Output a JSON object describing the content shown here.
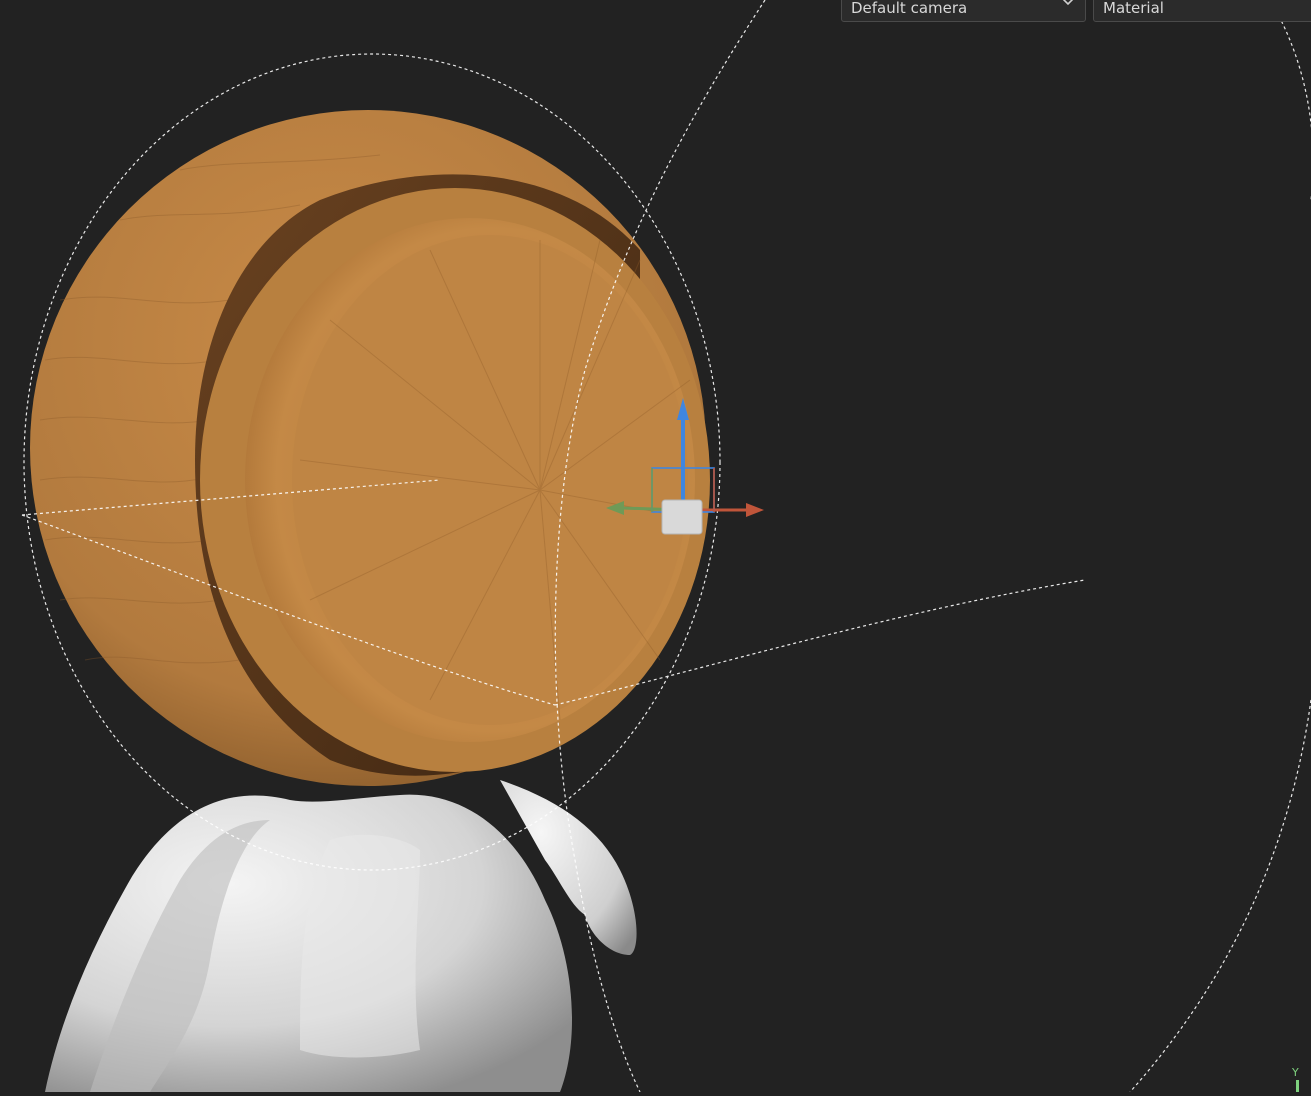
{
  "viewport": {
    "camera_select": {
      "value": "Default camera"
    },
    "shading_select": {
      "value": "Material"
    },
    "axis_indicator": {
      "y_label": "Y"
    }
  },
  "colors": {
    "background": "#222222",
    "wood": "#b27a3e",
    "body": "#dcdcdc",
    "gizmo_x": "#c0553a",
    "gizmo_y": "#6f9a57",
    "gizmo_z": "#3f86e0"
  },
  "icons": {
    "dropdown": "chevron-down-icon",
    "gizmo": "transform-gizmo-icon"
  }
}
